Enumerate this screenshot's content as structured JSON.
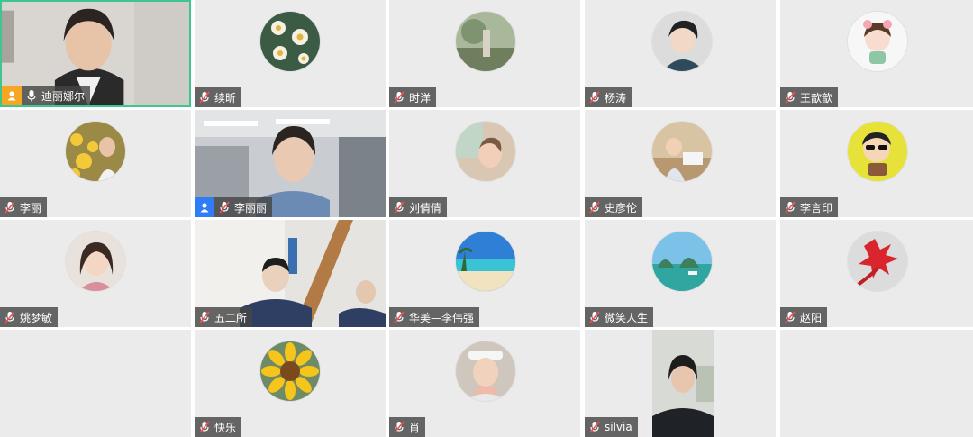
{
  "participants": [
    {
      "name": "迪丽娜尔",
      "mic": "mic-on-icon",
      "host": true,
      "badge_color": "#f5a623",
      "active": true
    },
    {
      "name": "续昕",
      "mic": "mic-muted-icon",
      "avatar": "daisy-flowers-photo"
    },
    {
      "name": "时洋",
      "mic": "mic-muted-icon",
      "avatar": "forest-painting-photo"
    },
    {
      "name": "杨涛",
      "mic": "mic-muted-icon",
      "avatar": "anime-boy-photo"
    },
    {
      "name": "王歆歆",
      "mic": "mic-muted-icon",
      "avatar": "cartoon-girl-photo"
    },
    {
      "name": "李丽",
      "mic": "mic-muted-icon",
      "avatar": "yellow-flower-girl-photo"
    },
    {
      "name": "李丽丽",
      "mic": "mic-muted-icon",
      "host": true,
      "badge_color": "#2f7cf6"
    },
    {
      "name": "刘倩倩",
      "mic": "mic-muted-icon",
      "avatar": "child-photo"
    },
    {
      "name": "史彦伦",
      "mic": "mic-muted-icon",
      "avatar": "child-desk-photo"
    },
    {
      "name": "李言印",
      "mic": "mic-muted-icon",
      "avatar": "cartoon-sunglasses-photo"
    },
    {
      "name": "姚梦敏",
      "mic": "mic-muted-icon",
      "avatar": "woman-portrait-photo"
    },
    {
      "name": "五二所",
      "mic": "mic-muted-icon"
    },
    {
      "name": "华美—李伟强",
      "mic": "mic-muted-icon",
      "avatar": "beach-photo"
    },
    {
      "name": "微笑人生",
      "mic": "mic-muted-icon",
      "avatar": "lake-mountain-photo"
    },
    {
      "name": "赵阳",
      "mic": "mic-muted-icon",
      "avatar": "red-leaf-photo"
    },
    {
      "name": "快乐",
      "mic": "mic-muted-icon",
      "avatar": "sunflower-photo"
    },
    {
      "name": "肖",
      "mic": "mic-muted-icon",
      "avatar": "heart-hands-girl-photo"
    },
    {
      "name": "silvia",
      "mic": "mic-muted-icon"
    }
  ],
  "colors": {
    "active_border": "#3fc68f",
    "tile_bg": "#ebebeb",
    "namebar_bg": "#464646"
  }
}
